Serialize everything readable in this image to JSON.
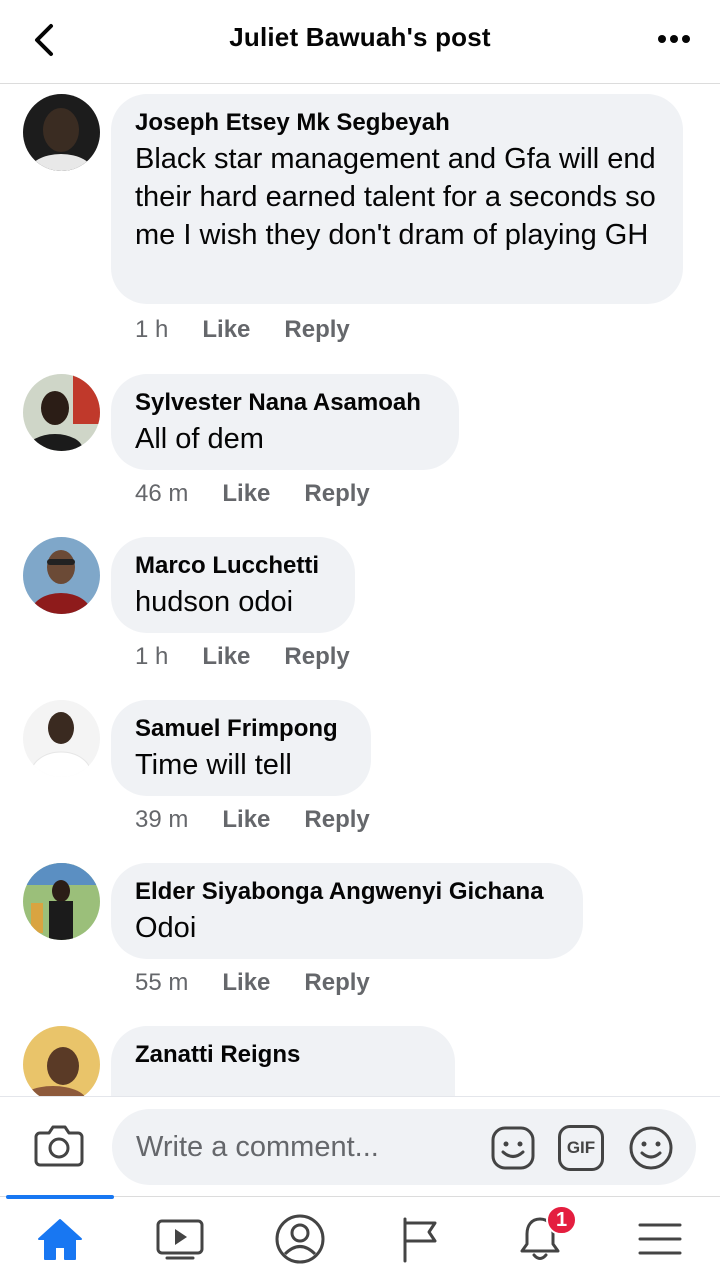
{
  "header": {
    "title": "Juliet Bawuah's post",
    "back_icon": "chevron-left-icon",
    "more_icon": "more-dots-icon"
  },
  "comments": [
    {
      "author": "Joseph Etsey Mk Segbeyah",
      "text": "Black star management and Gfa will end their hard earned talent for a seconds so me I wish they don't dram of playing GH",
      "time": "1 h",
      "like": "Like",
      "reply": "Reply"
    },
    {
      "author": "Sylvester Nana Asamoah",
      "text": "All of dem",
      "time": "46 m",
      "like": "Like",
      "reply": "Reply"
    },
    {
      "author": "Marco Lucchetti",
      "text": "hudson odoi",
      "time": "1 h",
      "like": "Like",
      "reply": "Reply"
    },
    {
      "author": "Samuel Frimpong",
      "text": "Time will tell",
      "time": "39 m",
      "like": "Like",
      "reply": "Reply"
    },
    {
      "author": "Elder Siyabonga Angwenyi Gichana",
      "text": "Odoi",
      "time": "55 m",
      "like": "Like",
      "reply": "Reply"
    },
    {
      "author": "Zanatti Reigns"
    }
  ],
  "composer": {
    "placeholder": "Write a comment...",
    "camera_icon": "camera-icon",
    "sticker_icon": "sticker-icon",
    "gif_label": "GIF",
    "emoji_icon": "emoji-icon"
  },
  "tabbar": {
    "tabs": [
      {
        "icon": "home-icon",
        "active": true
      },
      {
        "icon": "video-icon",
        "active": false
      },
      {
        "icon": "profile-icon",
        "active": false
      },
      {
        "icon": "pages-flag-icon",
        "active": false
      },
      {
        "icon": "notifications-bell-icon",
        "active": false,
        "badge": "1"
      },
      {
        "icon": "menu-icon",
        "active": false
      }
    ]
  },
  "colors": {
    "accent": "#1877f2",
    "bubble": "#f0f2f5",
    "meta_text": "#65676b",
    "badge": "#e41e3f"
  }
}
